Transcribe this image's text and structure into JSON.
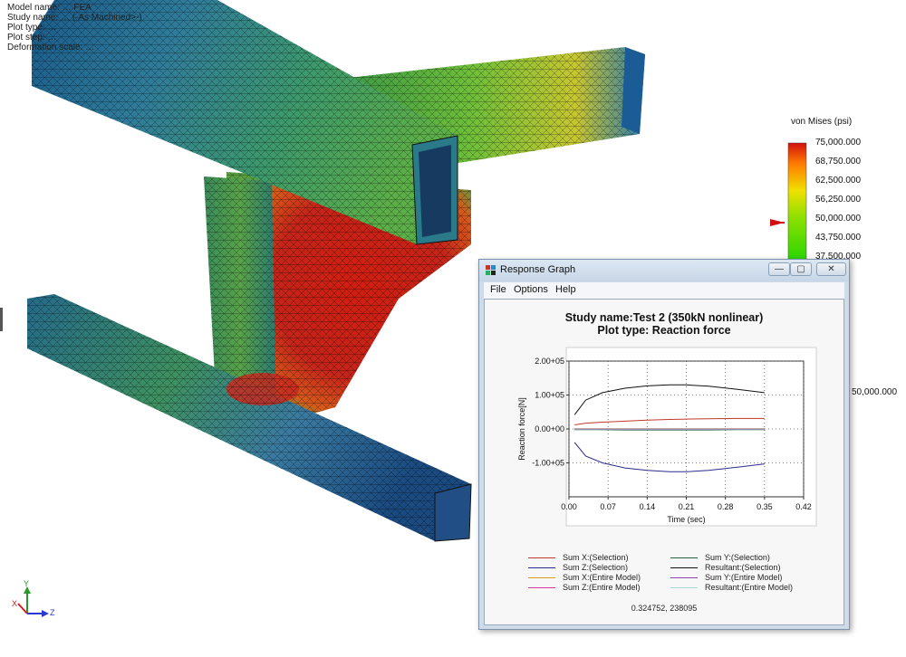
{
  "header_lines": [
    "Model name: … FEA",
    "Study name: … (-As Machined>-)",
    "Plot type: …",
    "Plot step: …",
    "Deformation scale: …"
  ],
  "legend": {
    "title": "von Mises (psi)",
    "ticks": [
      "75,000.000",
      "68,750.000",
      "62,500.000",
      "56,250.000",
      "50,000.000",
      "43,750.000",
      "37,500.000"
    ],
    "marker_value": "50,000.000",
    "peek_label": "50,000.000"
  },
  "triad": {
    "x": "X",
    "y": "Y",
    "z": "Z"
  },
  "window": {
    "title": "Response Graph",
    "buttons": {
      "minimize": "—",
      "maximize": "▢",
      "close": "✕"
    },
    "menu": [
      "File",
      "Options",
      "Help"
    ]
  },
  "chart_data": {
    "type": "line",
    "title": "Study name:Test 2 (350kN nonlinear)",
    "subtitle": "Plot type: Reaction force",
    "xlabel": "Time (sec)",
    "ylabel": "Reaction force[N]",
    "xlim": [
      0.0,
      0.42
    ],
    "ylim": [
      -200000,
      200000
    ],
    "xticks": [
      0.0,
      0.07,
      0.14,
      0.21,
      0.28,
      0.35,
      0.42
    ],
    "xtick_labels": [
      "0.00",
      "0.07",
      "0.14",
      "0.21",
      "0.28",
      "0.35",
      "0.42"
    ],
    "yticks": [
      200000,
      100000,
      0,
      -100000
    ],
    "ytick_labels": [
      "2.00+05",
      "1.00+05",
      "0.00+00",
      "-1.00+05"
    ],
    "grid": true,
    "legend_placement": "bottom",
    "series": [
      {
        "name": "Sum X:(Selection)",
        "color": "#c0392b",
        "x": [
          0.01,
          0.03,
          0.06,
          0.1,
          0.14,
          0.18,
          0.21,
          0.25,
          0.3,
          0.35
        ],
        "y": [
          12000,
          17000,
          20000,
          23000,
          26000,
          28000,
          29000,
          30000,
          31000,
          31000
        ]
      },
      {
        "name": "Sum Y:(Selection)",
        "color": "#27613f",
        "x": [
          0.01,
          0.05,
          0.1,
          0.15,
          0.2,
          0.25,
          0.3,
          0.35
        ],
        "y": [
          -2000,
          -2000,
          -3000,
          -3000,
          -3000,
          -3000,
          -2000,
          -2000
        ]
      },
      {
        "name": "Sum Z:(Selection)",
        "color": "#2b2b8c",
        "x": [
          0.01,
          0.03,
          0.06,
          0.1,
          0.14,
          0.18,
          0.21,
          0.25,
          0.3,
          0.35
        ],
        "y": [
          -40000,
          -80000,
          -100000,
          -115000,
          -122000,
          -126000,
          -126000,
          -122000,
          -113000,
          -103000
        ]
      },
      {
        "name": "Resultant:(Selection)",
        "color": "#111111",
        "x": [
          0.01,
          0.03,
          0.06,
          0.1,
          0.14,
          0.18,
          0.21,
          0.25,
          0.3,
          0.35
        ],
        "y": [
          42000,
          85000,
          107000,
          120000,
          127000,
          130000,
          130000,
          126000,
          117000,
          107000
        ]
      },
      {
        "name": "Sum X:(Entire Model)",
        "color": "#d4a017",
        "x": [
          0.01,
          0.1,
          0.2,
          0.3,
          0.35
        ],
        "y": [
          1000,
          1000,
          1000,
          1000,
          1000
        ]
      },
      {
        "name": "Sum Y:(Entire Model)",
        "color": "#8e44ad",
        "x": [
          0.01,
          0.1,
          0.2,
          0.3,
          0.35
        ],
        "y": [
          -1000,
          -1000,
          -1000,
          -1000,
          -1000
        ]
      },
      {
        "name": "Sum Z:(Entire Model)",
        "color": "#d63aa3",
        "x": [
          0.01,
          0.1,
          0.2,
          0.3,
          0.35
        ],
        "y": [
          500,
          500,
          500,
          500,
          500
        ]
      },
      {
        "name": "Resultant:(Entire Model)",
        "color": "#a8d8cf",
        "x": [
          0.01,
          0.1,
          0.2,
          0.3,
          0.35
        ],
        "y": [
          0,
          0,
          0,
          0,
          0
        ]
      }
    ]
  },
  "status_coords": "0.324752, 238095"
}
